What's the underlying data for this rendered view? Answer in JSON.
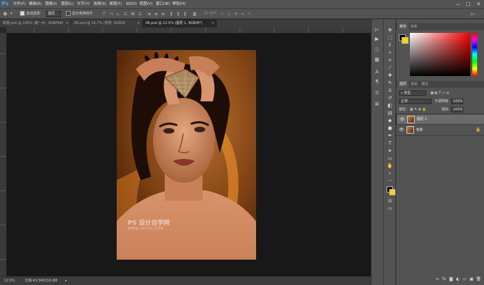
{
  "app": {
    "logo": "Ps"
  },
  "menu": {
    "items": [
      "文件(F)",
      "编辑(E)",
      "图像(I)",
      "图层(L)",
      "文字(Y)",
      "选择(S)",
      "滤镜(T)",
      "3D(D)",
      "视图(V)",
      "窗口(W)",
      "帮助(H)"
    ]
  },
  "window_controls": {
    "minimize": "—",
    "maximize": "□",
    "close": "✕"
  },
  "options": {
    "auto_select_label": "自动选择：",
    "auto_select_value": "图层",
    "transform_label": "显示变换控件"
  },
  "tabs": [
    {
      "label": "新建.psd @ 100% (第一步，RGB/8#)",
      "close": "×"
    },
    {
      "label": "08.psd @ 16.7% (背景, RGB/8)",
      "close": "×"
    },
    {
      "label": "08.psd @ 12.5% (图层 1, RGB/8*)",
      "close": "×"
    }
  ],
  "watermark": {
    "line1": "PS 设计自学网",
    "line2": "WWW.16XX8.COM"
  },
  "status": {
    "zoom": "12.5%",
    "doc": "文档:43.5M/116.6M",
    "arrow": "▸"
  },
  "color_panel": {
    "tabs": [
      "颜色",
      "色板"
    ]
  },
  "layers_panel": {
    "tabs": [
      "图层",
      "通道",
      "路径"
    ],
    "filter_kind": "类型",
    "blend_mode": "正常",
    "opacity_label": "不透明度:",
    "opacity_value": "100%",
    "lock_label": "锁定:",
    "fill_label": "填充:",
    "fill_value": "100%",
    "layers": [
      {
        "name": "图层 1",
        "eye": "👁",
        "selected": true
      },
      {
        "name": "背景",
        "eye": "👁",
        "locked": true,
        "lock": "🔒"
      }
    ]
  }
}
